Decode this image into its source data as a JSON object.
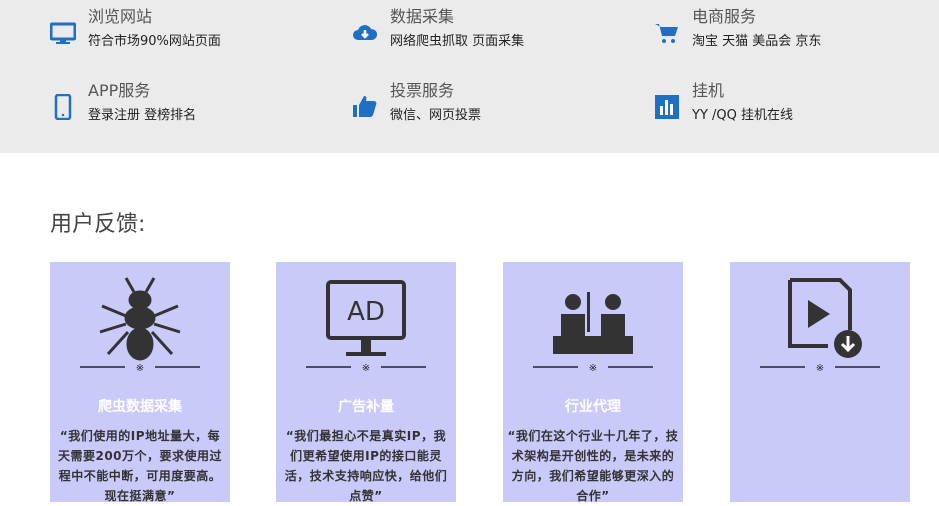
{
  "services": [
    {
      "icon": "monitor-icon",
      "title": "浏览网站",
      "sub": "符合市场90%网站页面"
    },
    {
      "icon": "cloud-download-icon",
      "title": "数据采集",
      "sub": "网络爬虫抓取 页面采集"
    },
    {
      "icon": "cart-icon",
      "title": "电商服务",
      "sub": "淘宝 天猫 美品会 京东"
    },
    {
      "icon": "phone-icon",
      "title": "APP服务",
      "sub": "登录注册 登榜排名"
    },
    {
      "icon": "thumbs-up-icon",
      "title": "投票服务",
      "sub": "微信、网页投票"
    },
    {
      "icon": "bar-chart-icon",
      "title": "挂机",
      "sub": "YY /QQ 挂机在线"
    }
  ],
  "feedback": {
    "title": "用户反馈:",
    "cards": [
      {
        "icon": "ant-icon",
        "heading": "爬虫数据采集",
        "quote": "“我们使用的IP地址量大，每天需要200万个，要求使用过程中不能中断，可用度要高。现在挺满意”"
      },
      {
        "icon": "ad-monitor-icon",
        "heading": "广告补量",
        "quote": "“我们最担心不是真实IP，我们更希望使用IP的接口能灵活，技术支持响应快，给他们点赞”"
      },
      {
        "icon": "meeting-icon",
        "heading": "行业代理",
        "quote": "“我们在这个行业十几年了，技术架构是开创性的，是未来的方向，我们希望能够更深入的合作”"
      },
      {
        "icon": "video-download-icon",
        "heading": "",
        "quote": ""
      }
    ]
  }
}
